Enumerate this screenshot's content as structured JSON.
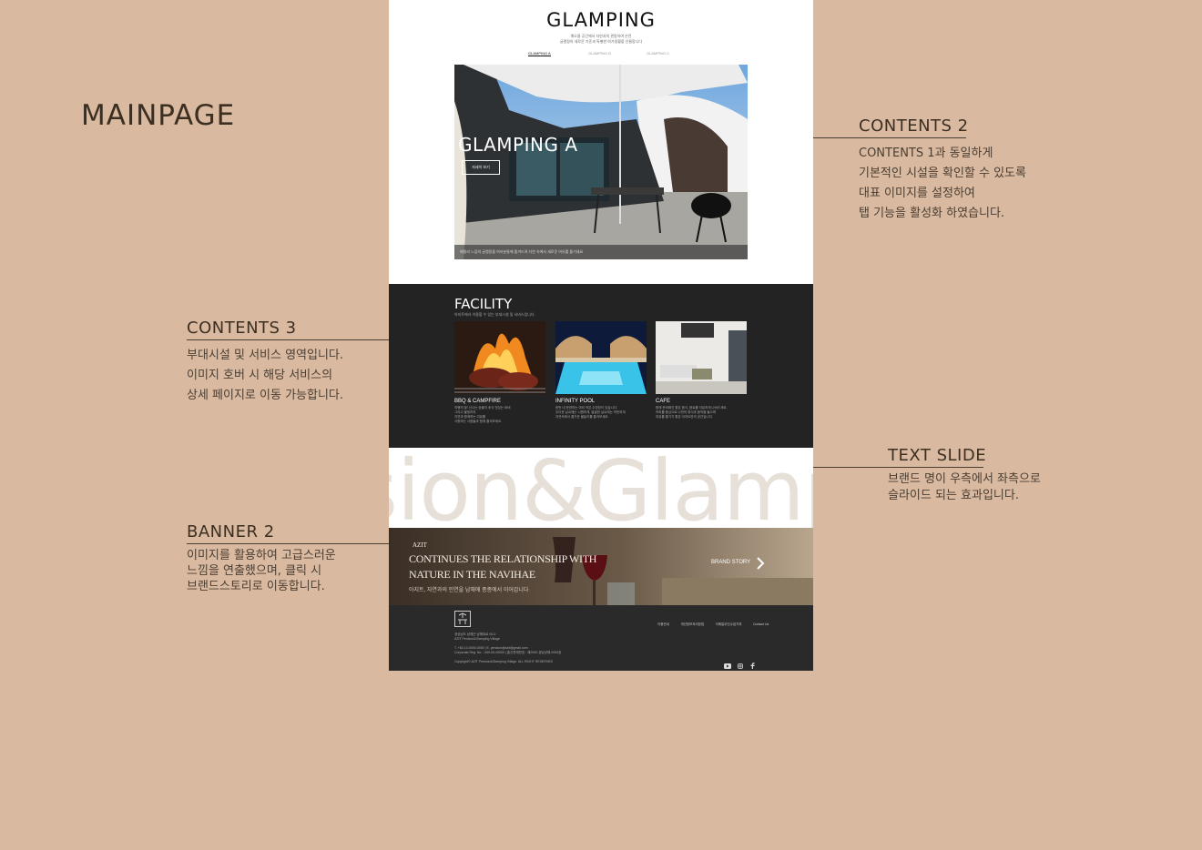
{
  "page": {
    "heading": "MAINPAGE"
  },
  "notes": {
    "contents2": {
      "title": "CONTENTS 2",
      "body": "CONTENTS 1과 동일하게\n기본적인 시설을 확인할 수 있도록\n대표 이미지를 설정하여\n탭 기능을 활성화 하였습니다."
    },
    "contents3": {
      "title": "CONTENTS 3",
      "body": "부대시설 및 서비스 영역입니다.\n이미지 호버 시 해당 서비스의\n상세 페이지로 이동 가능합니다."
    },
    "text_slide": {
      "title": "TEXT SLIDE",
      "body": "브랜드 명이 우측에서 좌측으로\n슬라이드 되는 효과입니다."
    },
    "banner2": {
      "title": "BANNER 2",
      "body": "이미지를 활용하여 고급스러운\n느낌을 연출했으며, 클릭 시\n브랜드스토리로 이동합니다."
    }
  },
  "mockup": {
    "brand": "GLAMPING",
    "tagline": "해오름 공간에서 자연과의 관람하여 온전\n글램핑의 새로운 기준과 특별한 여가생활을 선물합니다",
    "tabs": [
      "GLAMPING A",
      "GLAMPING B",
      "GLAMPING C"
    ],
    "active_tab": "GLAMPING A",
    "hero": {
      "title": "GLAMPING A",
      "button": "자세히 보기",
      "caption": "패밀리 느낌의 글램핑을 여러분들께 즐겨드려 자연 속에서 새로운 여유를 즐기세요"
    },
    "facility": {
      "title": "FACILITY",
      "subtitle": "아지트에서 이용할 수 있는 부대시설 및 서비스입니다.",
      "cards": [
        {
          "name": "BBQ & CAMPFIRE",
          "desc": "여행의 꽃! 신나는 숯불이 후식 맛있는 바비\n그리고 불멍까지\n자연과 함께하는 여유를\n사랑하는 사람들과 함께 즐겨보세요"
        },
        {
          "name": "INFINITY POOL",
          "desc": "한번 내 문양하는 야외 작은 수영장이 있습니다.\n무더운 날씨에는 시원하게, 쌀쌀한 날씨에는 따뜻하게\n자연속에서 즐거운 물놀이를 즐겨보세요."
        },
        {
          "name": "CAFE",
          "desc": "함께 준비돼진 좋은 음식, 음료를 자유하게 나눠드세요.\n커피를 중심으로 나만의 휴식과 음악을 들으며\n여유를 즐기기 좋은 아지트만의 공간입니다."
        }
      ]
    },
    "slide_text": "sion&Glamp",
    "banner": {
      "small": "AZIT",
      "headline": "CONTINUES THE RELATIONSHIP WITH\nNATURE IN THE NAVIHAE",
      "korean": "아지트, 자연과의 인연을 남해에 종종에서 이어갑니다",
      "link": "BRAND STORY"
    },
    "footer": {
      "logo_text": "아지트",
      "info": "경상남도 남해군 남해대로 00-0\nAZIT Pension&Glamping Village\n\nT. +82-10-0000-0000  |  E. pension@azit@gmail.com\nCorporate Reg. No. : 000-00-00000  |  통신판매번호 : 제0000-경남남해-0000호\n\nCopyright© AZIT Pension&Glamping Village. ALL RIGHT RESERVED",
      "nav": [
        "이용안내",
        "개인정보처리방침",
        "이메일무단수집거부",
        "Contact Us"
      ],
      "social_icons": [
        "youtube-icon",
        "instagram-icon",
        "facebook-icon"
      ]
    }
  },
  "colors": {
    "background": "#d9b9a0",
    "dark_section": "#232323",
    "text": "#3b2f22"
  }
}
